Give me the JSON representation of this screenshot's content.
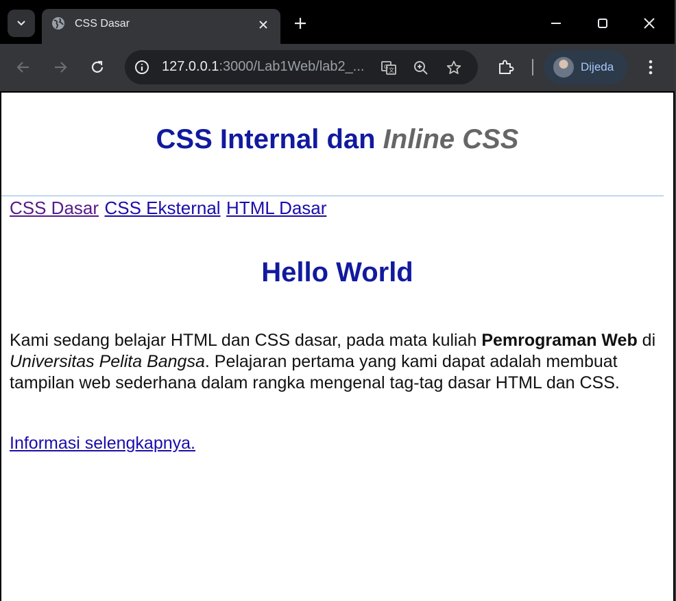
{
  "browser": {
    "tab": {
      "title": "CSS Dasar"
    },
    "address": {
      "host": "127.0.0.1",
      "rest": ":3000/Lab1Web/lab2_..."
    },
    "profile": {
      "name": "Dijeda"
    }
  },
  "page": {
    "heading": {
      "normal": "CSS Internal dan ",
      "italic": "Inline CSS"
    },
    "nav": [
      {
        "label": "CSS Dasar"
      },
      {
        "label": "CSS Eksternal"
      },
      {
        "label": "HTML Dasar"
      }
    ],
    "subheading": "Hello World",
    "paragraph": {
      "part1": "Kami sedang belajar HTML dan CSS dasar, pada mata kuliah ",
      "bold": "Pemrograman Web",
      "part2": " di ",
      "italic": "Universitas Pelita Bangsa",
      "part3": ". Pelajaran pertama yang kami dapat adalah membuat tampilan web sederhana dalam rangka mengenal tag-tag dasar HTML dan CSS."
    },
    "more_link": "Informasi selengkapnya."
  }
}
